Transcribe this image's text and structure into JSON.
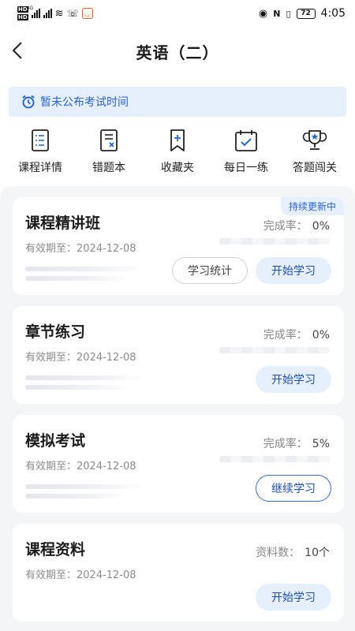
{
  "status_bar": {
    "time": "4:05",
    "battery": "72",
    "network": "4G",
    "icons": [
      "hd-icon",
      "signal-icon",
      "wifi-icon",
      "call-icon",
      "app-icon",
      "eye-icon",
      "nfc-icon",
      "vibrate-icon",
      "battery-icon"
    ]
  },
  "header": {
    "title": "英语（二）",
    "back_icon": "chevron-left-icon"
  },
  "notice": {
    "icon": "alarm-clock-icon",
    "text": "暂未公布考试时间"
  },
  "quick_menu": [
    {
      "label": "课程详情",
      "icon": "list-document-icon"
    },
    {
      "label": "错题本",
      "icon": "wrong-answer-icon"
    },
    {
      "label": "收藏夹",
      "icon": "bookmark-icon"
    },
    {
      "label": "每日一练",
      "icon": "calendar-check-icon"
    },
    {
      "label": "答题闯关",
      "icon": "trophy-icon"
    }
  ],
  "cards": [
    {
      "title": "课程精讲班",
      "valid": "有效期至：2024-12-08",
      "stat_label": "完成率：",
      "stat_value": "0%",
      "tag": "持续更新中",
      "secondary_button": "学习统计",
      "primary_button": "开始学习"
    },
    {
      "title": "章节练习",
      "valid": "有效期至：2024-12-08",
      "stat_label": "完成率：",
      "stat_value": "0%",
      "primary_button": "开始学习"
    },
    {
      "title": "模拟考试",
      "valid": "有效期至：2024-12-08",
      "stat_label": "完成率：",
      "stat_value": "5%",
      "primary_button": "继续学习"
    },
    {
      "title": "课程资料",
      "valid": "有效期至：2024-12-08",
      "stat_label": "资料数：",
      "stat_value": "10个",
      "primary_button": "开始学习"
    }
  ],
  "colors": {
    "accent": "#2a66d8",
    "notice_bg": "#e6effc",
    "page_bg": "#f4f5f7"
  }
}
